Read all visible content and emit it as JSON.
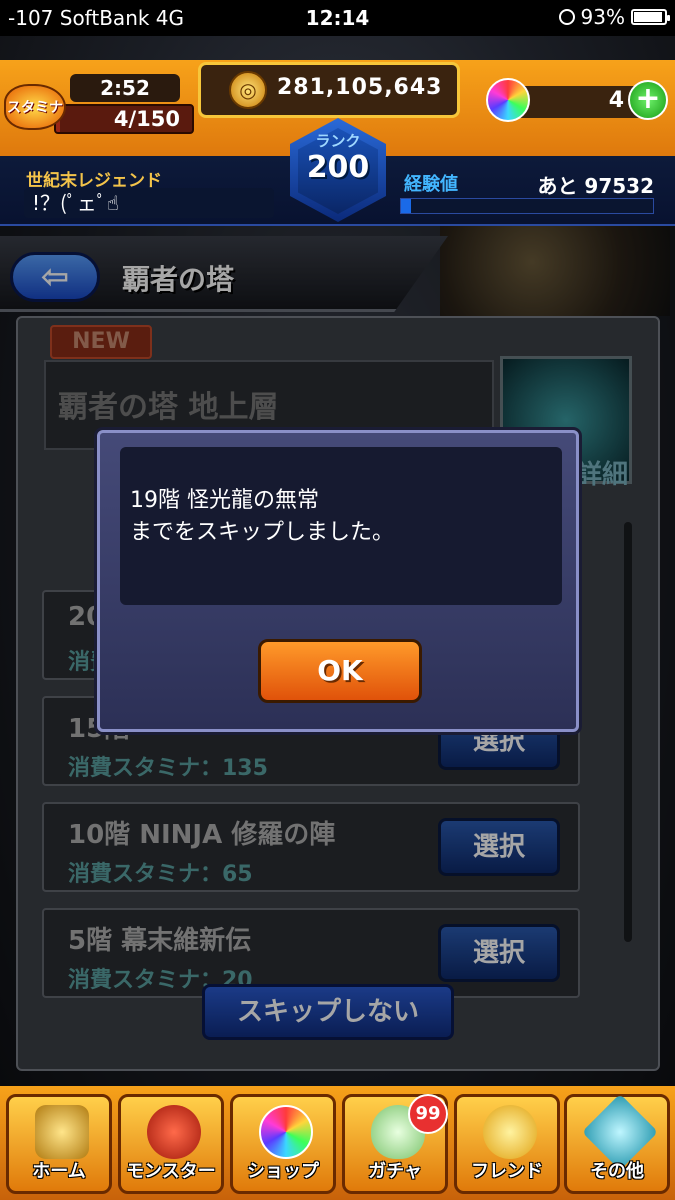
{
  "status_bar": {
    "carrier": "-107 SoftBank   4G",
    "time": "12:14",
    "battery": "93%",
    "battery_level": 0.93
  },
  "hud": {
    "stamina_label": "スタミナ",
    "stamina_timer": "2:52",
    "stamina_value": "4/150",
    "stamina_fraction": 0.027,
    "gold": "281,105,643",
    "orbs": "4",
    "plus_symbol": "+",
    "player_name": "世紀末レジェンド",
    "player_comment": "!？(ﾟェﾟ☝",
    "rank_label": "ランク",
    "rank_value": "200",
    "exp_label": "経験値",
    "exp_remaining": "あと 97532",
    "exp_fraction": 0.04
  },
  "header": {
    "back_symbol": "⇦",
    "title": "覇者の塔"
  },
  "panel": {
    "new_badge": "NEW",
    "stage_title": "覇者の塔 地上層",
    "detail_button": "詳細",
    "floors": [
      {
        "title": "20",
        "cost": "消費"
      },
      {
        "title": "15階",
        "cost": "消費スタミナ：135",
        "button": "選択"
      },
      {
        "title": "10階 NINJA 修羅の陣",
        "cost": "消費スタミナ：65",
        "button": "選択"
      },
      {
        "title": "5階 幕末維新伝",
        "cost": "消費スタミナ：20",
        "button": "選択"
      }
    ],
    "no_skip_button": "スキップしない"
  },
  "modal": {
    "line1": "19階 怪光龍の無常",
    "line2": "までをスキップしました。",
    "ok_button": "OK"
  },
  "bottom_nav": {
    "items": [
      {
        "label": "ホーム",
        "icon": "home-tower-icon"
      },
      {
        "label": "モンスター",
        "icon": "monster-icon"
      },
      {
        "label": "ショップ",
        "icon": "orb-shop-icon"
      },
      {
        "label": "ガチャ",
        "icon": "egg-gacha-icon"
      },
      {
        "label": "フレンド",
        "icon": "friends-icon"
      },
      {
        "label": "その他",
        "icon": "other-menu-icon"
      }
    ],
    "gacha_badge": "99"
  }
}
